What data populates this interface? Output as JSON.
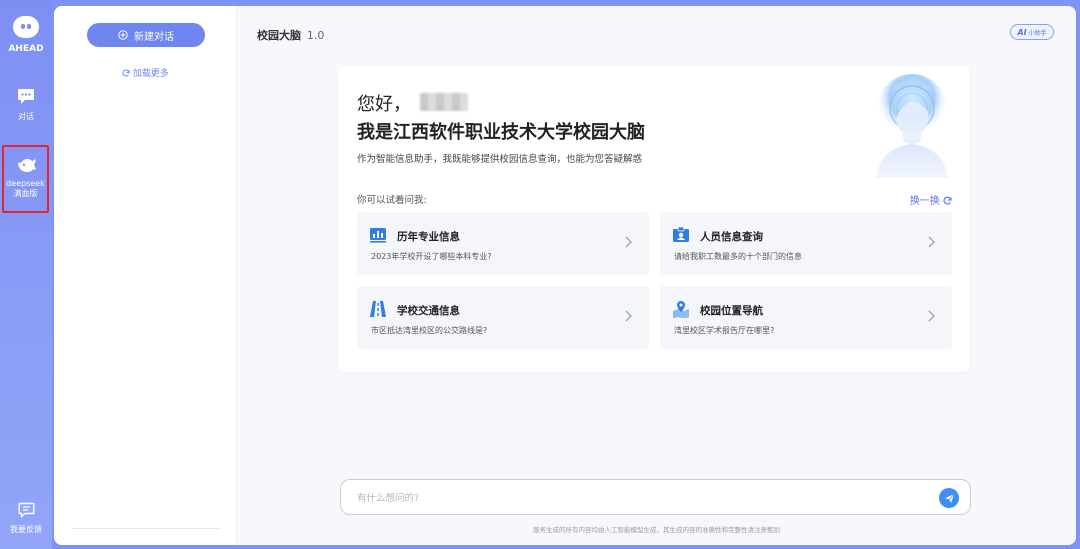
{
  "rail": {
    "logo_text": "AHEAD",
    "items": [
      {
        "label": "对话"
      },
      {
        "label_line1": "deepseek",
        "label_line2": "满血版"
      },
      {
        "label": "我要反馈"
      }
    ]
  },
  "history": {
    "new_chat_label": "新建对话",
    "load_more_label": "加载更多"
  },
  "header": {
    "title": "校园大脑",
    "version": "1.0",
    "badge_ai": "AI",
    "badge_text": "小助手"
  },
  "welcome": {
    "greeting": "您好，",
    "headline": "我是江西软件职业技术大学校园大脑",
    "intro": "作为智能信息助手，我既能够提供校园信息查询，也能为您答疑解惑",
    "try_label": "你可以试着问我:",
    "refresh_label": "换一换",
    "questions": [
      {
        "title": "历年专业信息",
        "desc": "2023年学校开设了哪些本科专业?",
        "icon": "bar-chart-icon"
      },
      {
        "title": "人员信息查询",
        "desc": "请给我职工数最多的十个部门的信息",
        "icon": "id-card-icon"
      },
      {
        "title": "学校交通信息",
        "desc": "市区抵达湾里校区的公交路线是?",
        "icon": "road-icon"
      },
      {
        "title": "校园位置导航",
        "desc": "湾里校区学术报告厅在哪里?",
        "icon": "map-pin-icon"
      }
    ]
  },
  "input": {
    "placeholder": "有什么想问的?"
  },
  "footer": {
    "disclaimer": "服务生成的所有内容均由人工智能模型生成，其生成内容的准确性和完整性请注意甄别"
  },
  "colors": {
    "accent": "#6f86f0",
    "rail": "#7e8ff4",
    "highlight_border": "#e3262d",
    "send_button": "#3f8ef5"
  }
}
